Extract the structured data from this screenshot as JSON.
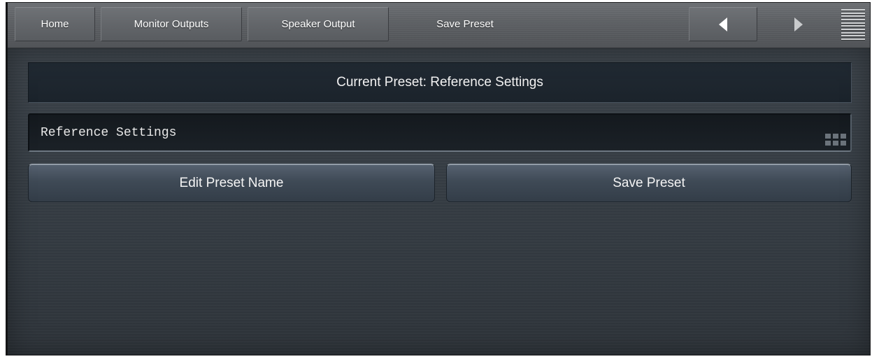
{
  "topbar": {
    "tabs": [
      {
        "label": "Home"
      },
      {
        "label": "Monitor Outputs"
      },
      {
        "label": "Speaker Output"
      },
      {
        "label": "Save Preset"
      }
    ],
    "nav": {
      "back_icon": "triangle-left-icon",
      "forward_icon": "triangle-right-icon",
      "menu_icon": "menu-lines-icon"
    }
  },
  "main": {
    "current_preset_text": "Current Preset: Reference Settings",
    "preset_name_value": "Reference Settings",
    "keypad_icon": "keypad-icon",
    "edit_button_label": "Edit Preset Name",
    "save_button_label": "Save Preset"
  },
  "colors": {
    "topbar": "#5f6266",
    "content_bg": "#363d44",
    "header_panel": "#1d252d",
    "button": "#46525e",
    "text": "#ffffff"
  }
}
